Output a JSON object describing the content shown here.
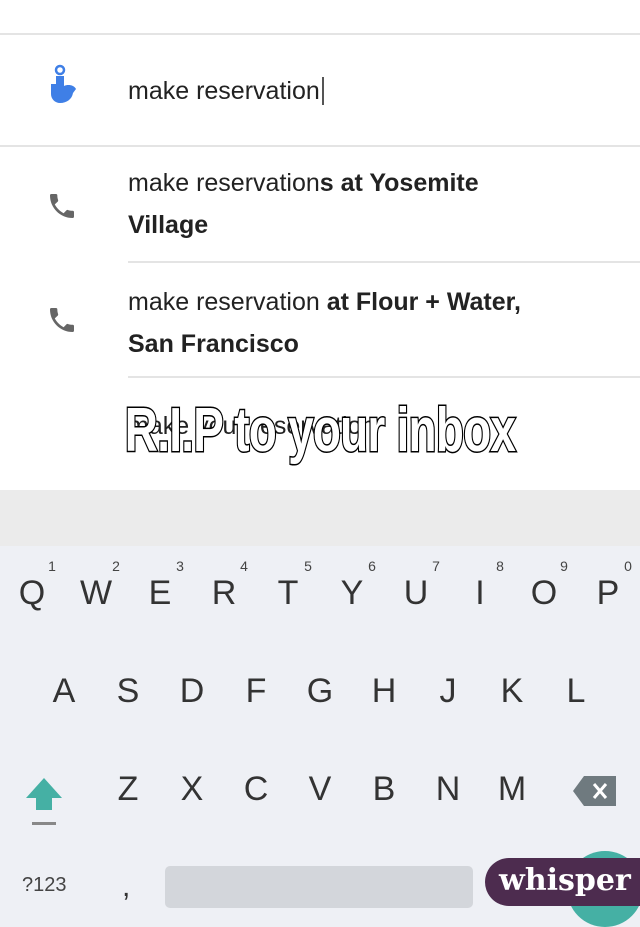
{
  "search": {
    "value": "make reservation"
  },
  "suggestions": [
    {
      "prefix": "make reservation",
      "bold_line1": "s at Yosemite",
      "line2": "Village",
      "icon": "phone-icon"
    },
    {
      "prefix": "make reservation ",
      "bold_line1": "at Flour + Water,",
      "line2": "San Francisco",
      "icon": "phone-icon"
    },
    {
      "partial": "make your reservation"
    }
  ],
  "keyboard": {
    "row1": [
      "Q",
      "W",
      "E",
      "R",
      "T",
      "Y",
      "U",
      "I",
      "O",
      "P"
    ],
    "row1_numbers": [
      "1",
      "2",
      "3",
      "4",
      "5",
      "6",
      "7",
      "8",
      "9",
      "0"
    ],
    "row2": [
      "A",
      "S",
      "D",
      "F",
      "G",
      "H",
      "J",
      "K",
      "L"
    ],
    "row3": [
      "Z",
      "X",
      "C",
      "V",
      "B",
      "N",
      "M"
    ],
    "symbols_key": "?123",
    "comma_key": ",",
    "accent": "#45b0a4"
  },
  "overlay_text": "R.I.P to your inbox",
  "watermark": "whisper"
}
